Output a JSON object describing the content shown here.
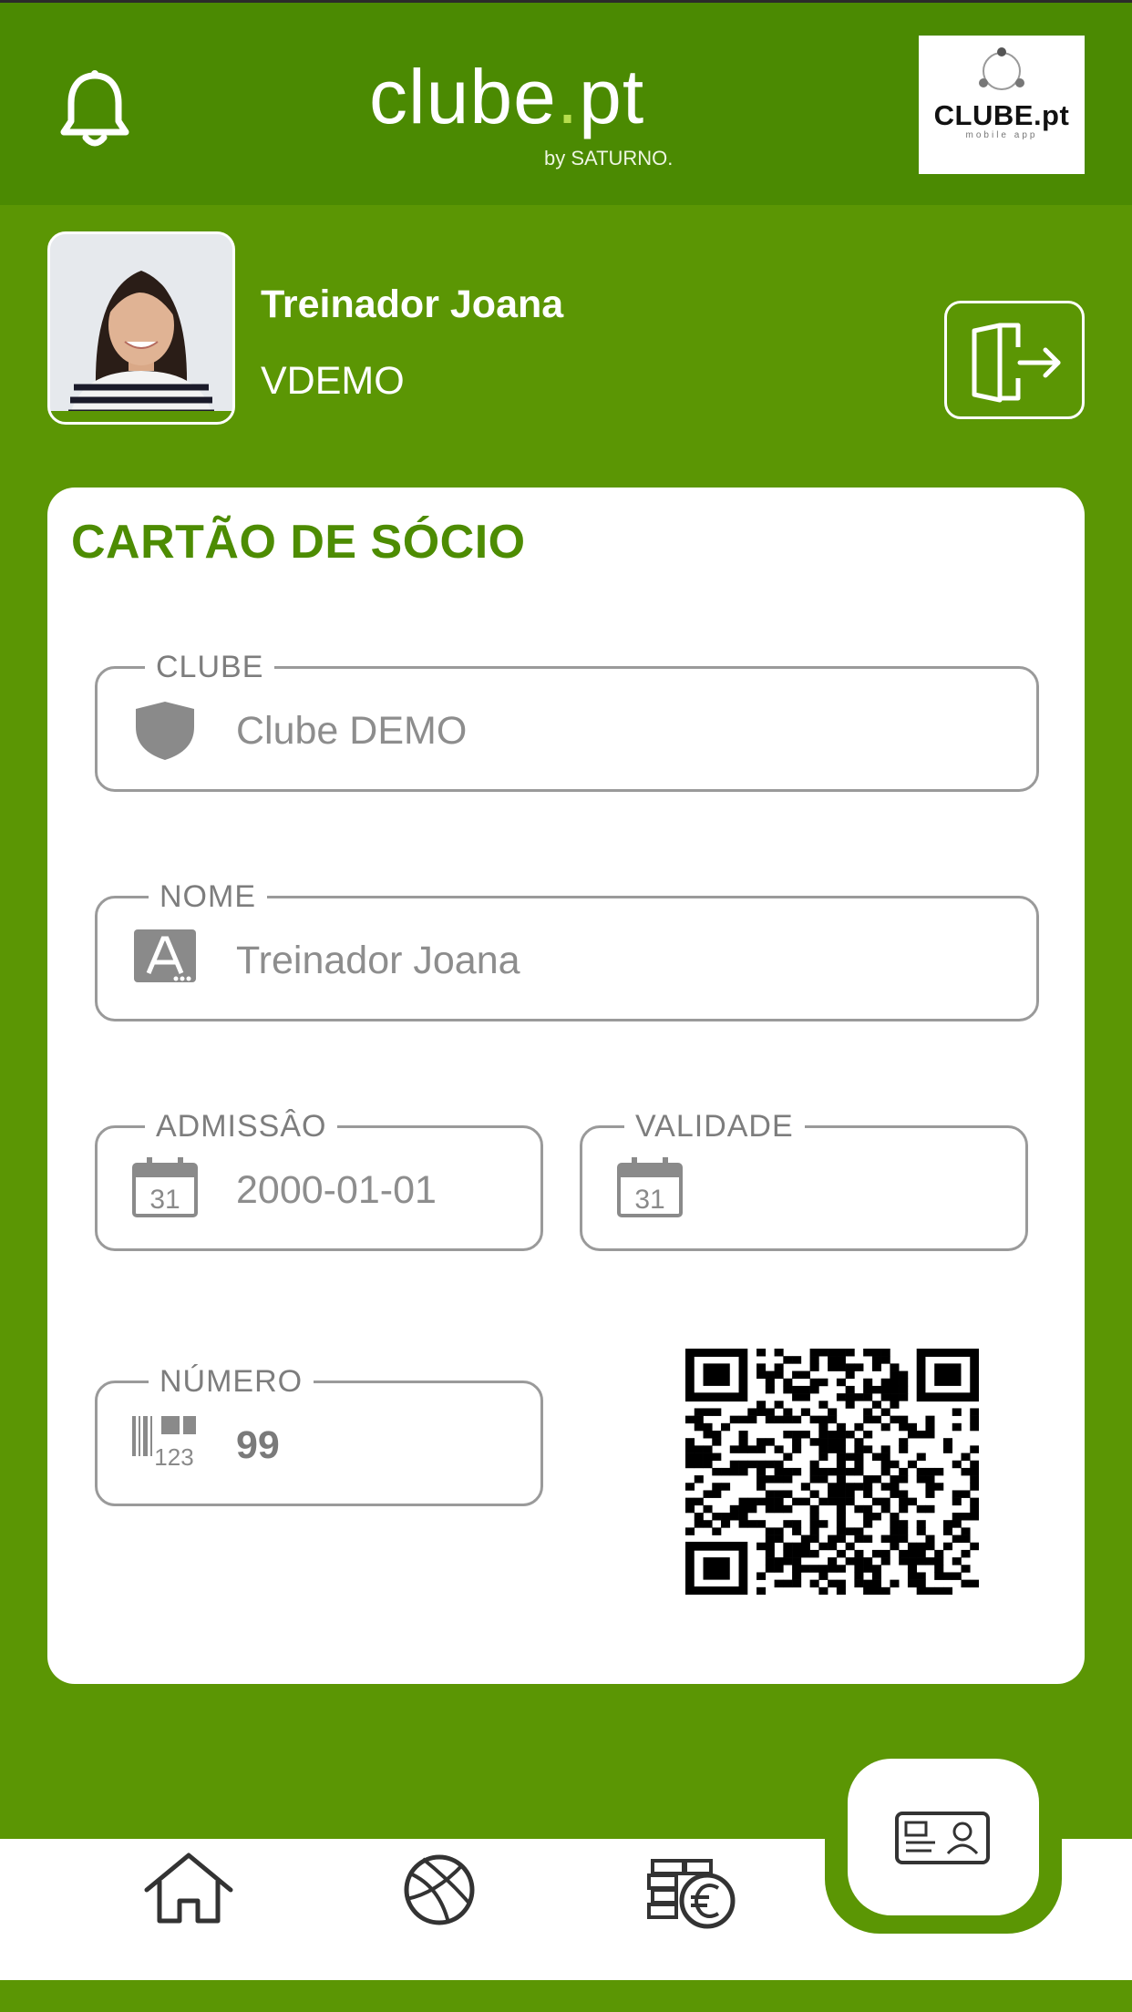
{
  "header": {
    "brand_main": "clube",
    "brand_dot": ".",
    "brand_tld": "pt",
    "brand_sub": "by SATURNO.",
    "partner_logo_title": "CLUBE.pt",
    "partner_logo_sub": "mobile app"
  },
  "user": {
    "name": "Treinador Joana",
    "club_code": "VDEMO"
  },
  "card": {
    "title": "CARTÃO DE SÓCIO",
    "fields": {
      "club": {
        "label": "CLUBE",
        "value": "Clube DEMO",
        "icon": "shield-icon"
      },
      "name": {
        "label": "NOME",
        "value": "Treinador Joana",
        "icon": "name-field-icon"
      },
      "admission": {
        "label": "ADMISSÂO",
        "value": "2000-01-01",
        "icon": "calendar-icon",
        "icon_text": "31"
      },
      "validity": {
        "label": "VALIDADE",
        "value": "",
        "icon": "calendar-icon",
        "icon_text": "31"
      },
      "number": {
        "label": "NÚMERO",
        "value": "99",
        "icon": "barcode-icon",
        "icon_text": "123"
      }
    }
  },
  "nav": {
    "items": [
      {
        "name": "home",
        "icon": "home-icon"
      },
      {
        "name": "sports",
        "icon": "basketball-icon"
      },
      {
        "name": "payments",
        "icon": "euro-coins-icon"
      },
      {
        "name": "member-card",
        "icon": "id-card-icon",
        "active": true
      }
    ]
  },
  "colors": {
    "primary": "#5b9604",
    "header": "#4b8a02",
    "title_green": "#4d8c02",
    "field_border": "#9a9a9a",
    "field_text": "#8d8d8d"
  }
}
